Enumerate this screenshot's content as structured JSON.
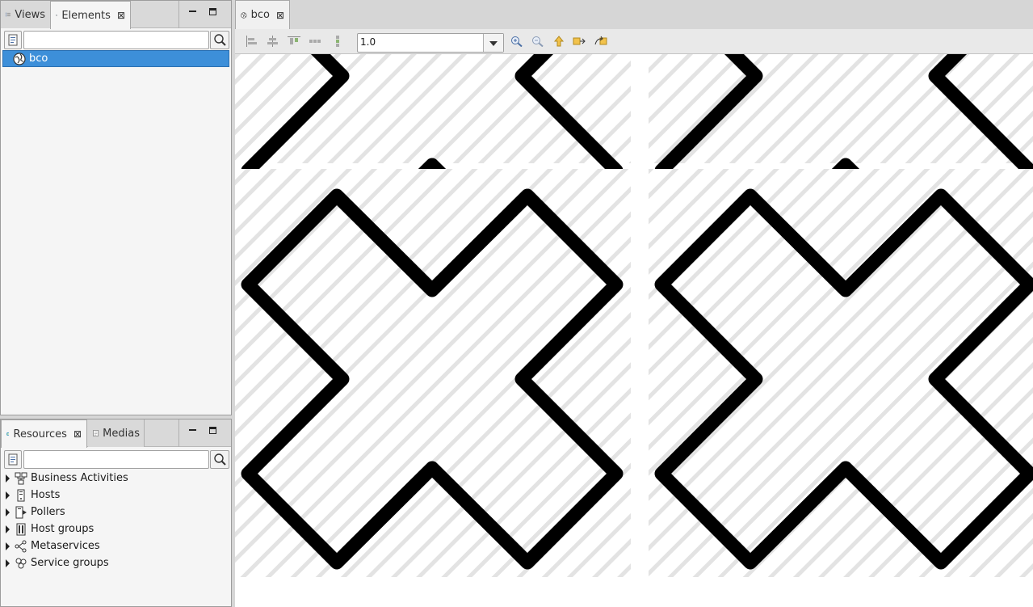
{
  "top_view": {
    "tabs": [
      {
        "label": "Views",
        "active": false
      },
      {
        "label": "Elements",
        "active": true
      }
    ],
    "filter_placeholder": "",
    "tree": [
      {
        "label": "bco",
        "selected": true
      }
    ]
  },
  "bottom_view": {
    "tabs": [
      {
        "label": "Resources",
        "active": true
      },
      {
        "label": "Medias",
        "active": false
      }
    ],
    "filter_placeholder": "",
    "tree": [
      {
        "label": "Business Activities"
      },
      {
        "label": "Hosts"
      },
      {
        "label": "Pollers"
      },
      {
        "label": "Host groups"
      },
      {
        "label": "Metaservices"
      },
      {
        "label": "Service groups"
      }
    ]
  },
  "editor": {
    "tab_label": "bco",
    "zoom_value": "1.0",
    "toolbar_icons": [
      "align-left-icon",
      "align-center-icon",
      "align-top-icon",
      "distribute-horizontal-icon",
      "distribute-vertical-icon",
      "zoom-in-icon",
      "zoom-out-icon",
      "go-up-icon",
      "export-icon",
      "import-icon"
    ],
    "missing_image_marks": 4
  },
  "colors": {
    "selection": "#3d8fd9",
    "panel_bg": "#f5f5f5",
    "tab_bg": "#d9d9d9"
  }
}
